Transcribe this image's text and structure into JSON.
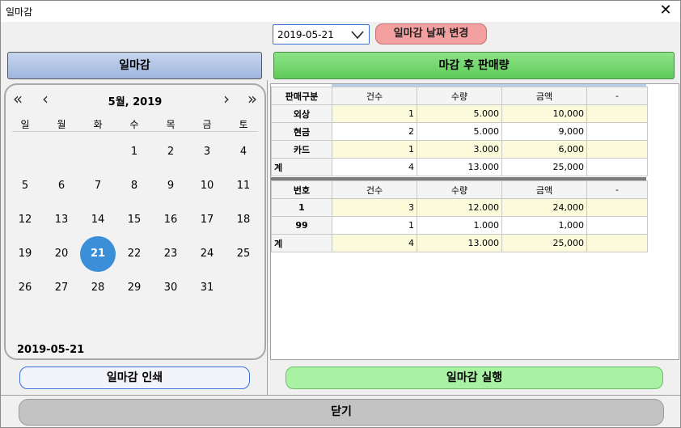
{
  "window": {
    "title": "일마감"
  },
  "toolbar": {
    "date_value": "2019-05-21",
    "change_date_label": "일마감 날짜 변경"
  },
  "left_header": {
    "label": "일마감"
  },
  "right_header": {
    "label": "마감 후 판매량"
  },
  "calendar": {
    "month_title": "5월, 2019",
    "weekdays": [
      "일",
      "월",
      "화",
      "수",
      "목",
      "금",
      "토"
    ],
    "days": [
      "1",
      "2",
      "3",
      "4",
      "5",
      "6",
      "7",
      "8",
      "9",
      "10",
      "11",
      "12",
      "13",
      "14",
      "15",
      "16",
      "17",
      "18",
      "19",
      "20",
      "21",
      "22",
      "23",
      "24",
      "25",
      "26",
      "27",
      "28",
      "29",
      "30",
      "31"
    ],
    "selected_day": "21",
    "footer_date": "2019-05-21"
  },
  "sales_by_type": {
    "headers": [
      "판매구분",
      "건수",
      "수량",
      "금액",
      "-"
    ],
    "rows": [
      [
        "외상",
        "1",
        "5.000",
        "10,000",
        ""
      ],
      [
        "현금",
        "2",
        "5.000",
        "9,000",
        ""
      ],
      [
        "카드",
        "1",
        "3.000",
        "6,000",
        ""
      ],
      [
        "계",
        "4",
        "13.000",
        "25,000",
        ""
      ]
    ]
  },
  "sales_by_number": {
    "headers": [
      "번호",
      "건수",
      "수량",
      "금액",
      "-"
    ],
    "rows": [
      [
        "1",
        "3",
        "12.000",
        "24,000",
        ""
      ],
      [
        "99",
        "1",
        "1.000",
        "1,000",
        ""
      ],
      [
        "계",
        "4",
        "13.000",
        "25,000",
        ""
      ]
    ]
  },
  "buttons": {
    "print_label": "일마감 인쇄",
    "run_label": "일마감 실행",
    "close_label": "닫기"
  }
}
